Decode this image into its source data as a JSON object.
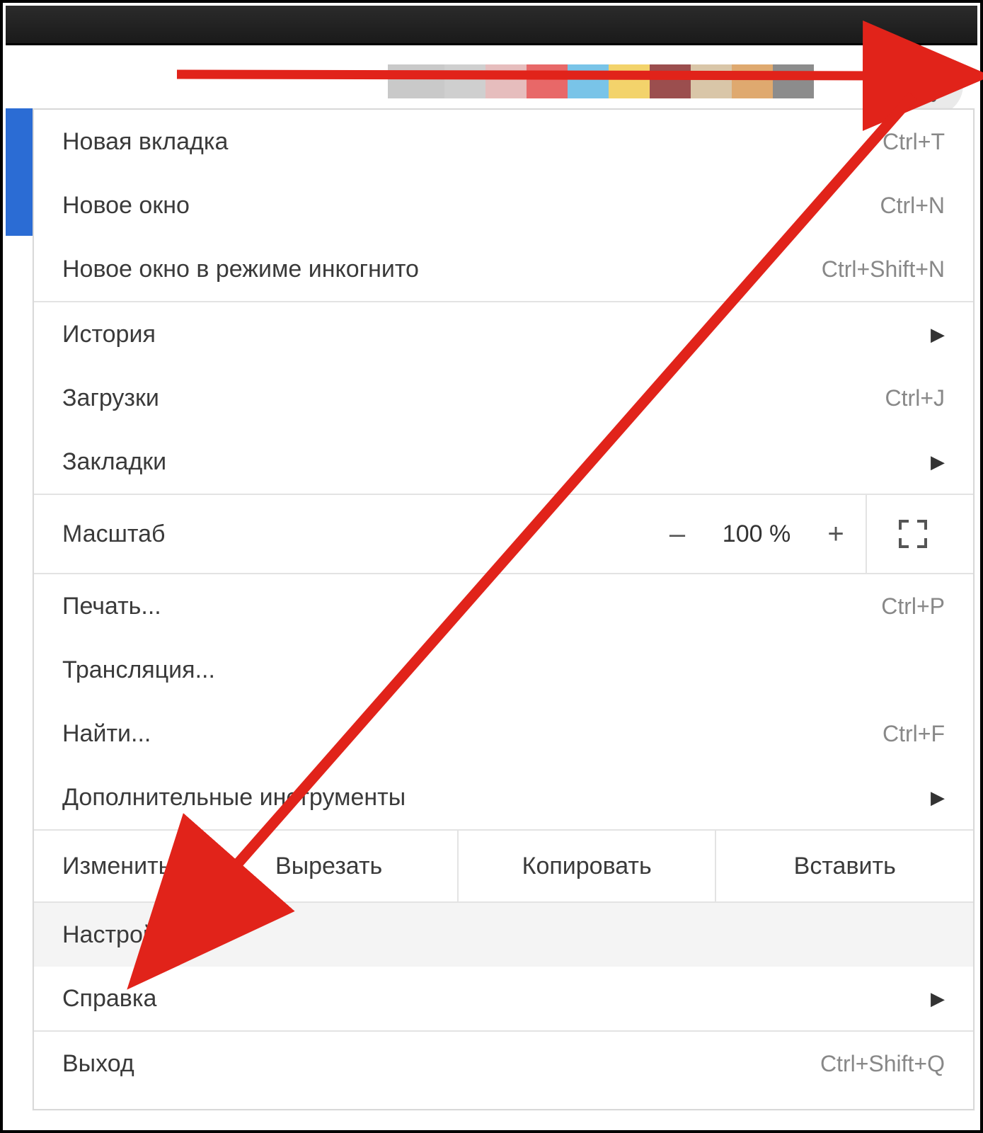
{
  "menu": {
    "new_tab": {
      "label": "Новая вкладка",
      "shortcut": "Ctrl+T"
    },
    "new_window": {
      "label": "Новое окно",
      "shortcut": "Ctrl+N"
    },
    "new_incognito": {
      "label": "Новое окно в режиме инкогнито",
      "shortcut": "Ctrl+Shift+N"
    },
    "history": {
      "label": "История"
    },
    "downloads": {
      "label": "Загрузки",
      "shortcut": "Ctrl+J"
    },
    "bookmarks": {
      "label": "Закладки"
    },
    "zoom": {
      "label": "Масштаб",
      "value": "100 %",
      "minus": "–",
      "plus": "+"
    },
    "print": {
      "label": "Печать...",
      "shortcut": "Ctrl+P"
    },
    "cast": {
      "label": "Трансляция..."
    },
    "find": {
      "label": "Найти...",
      "shortcut": "Ctrl+F"
    },
    "more_tools": {
      "label": "Дополнительные инструменты"
    },
    "edit": {
      "label": "Изменить",
      "cut": "Вырезать",
      "copy": "Копировать",
      "paste": "Вставить"
    },
    "settings": {
      "label": "Настройки"
    },
    "help": {
      "label": "Справка"
    },
    "exit": {
      "label": "Выход",
      "shortcut": "Ctrl+Shift+Q"
    }
  },
  "colors": {
    "annotation_red": "#e1231a",
    "blue_edge": "#2b6cd4"
  },
  "tab_strip_colors": [
    "#c9c9c9",
    "#cfcfcf",
    "#e6bdbd",
    "#e86868",
    "#79c4e8",
    "#f3d36b",
    "#9b4e4e",
    "#d9c6a8",
    "#dfa96f",
    "#8c8c8c"
  ]
}
